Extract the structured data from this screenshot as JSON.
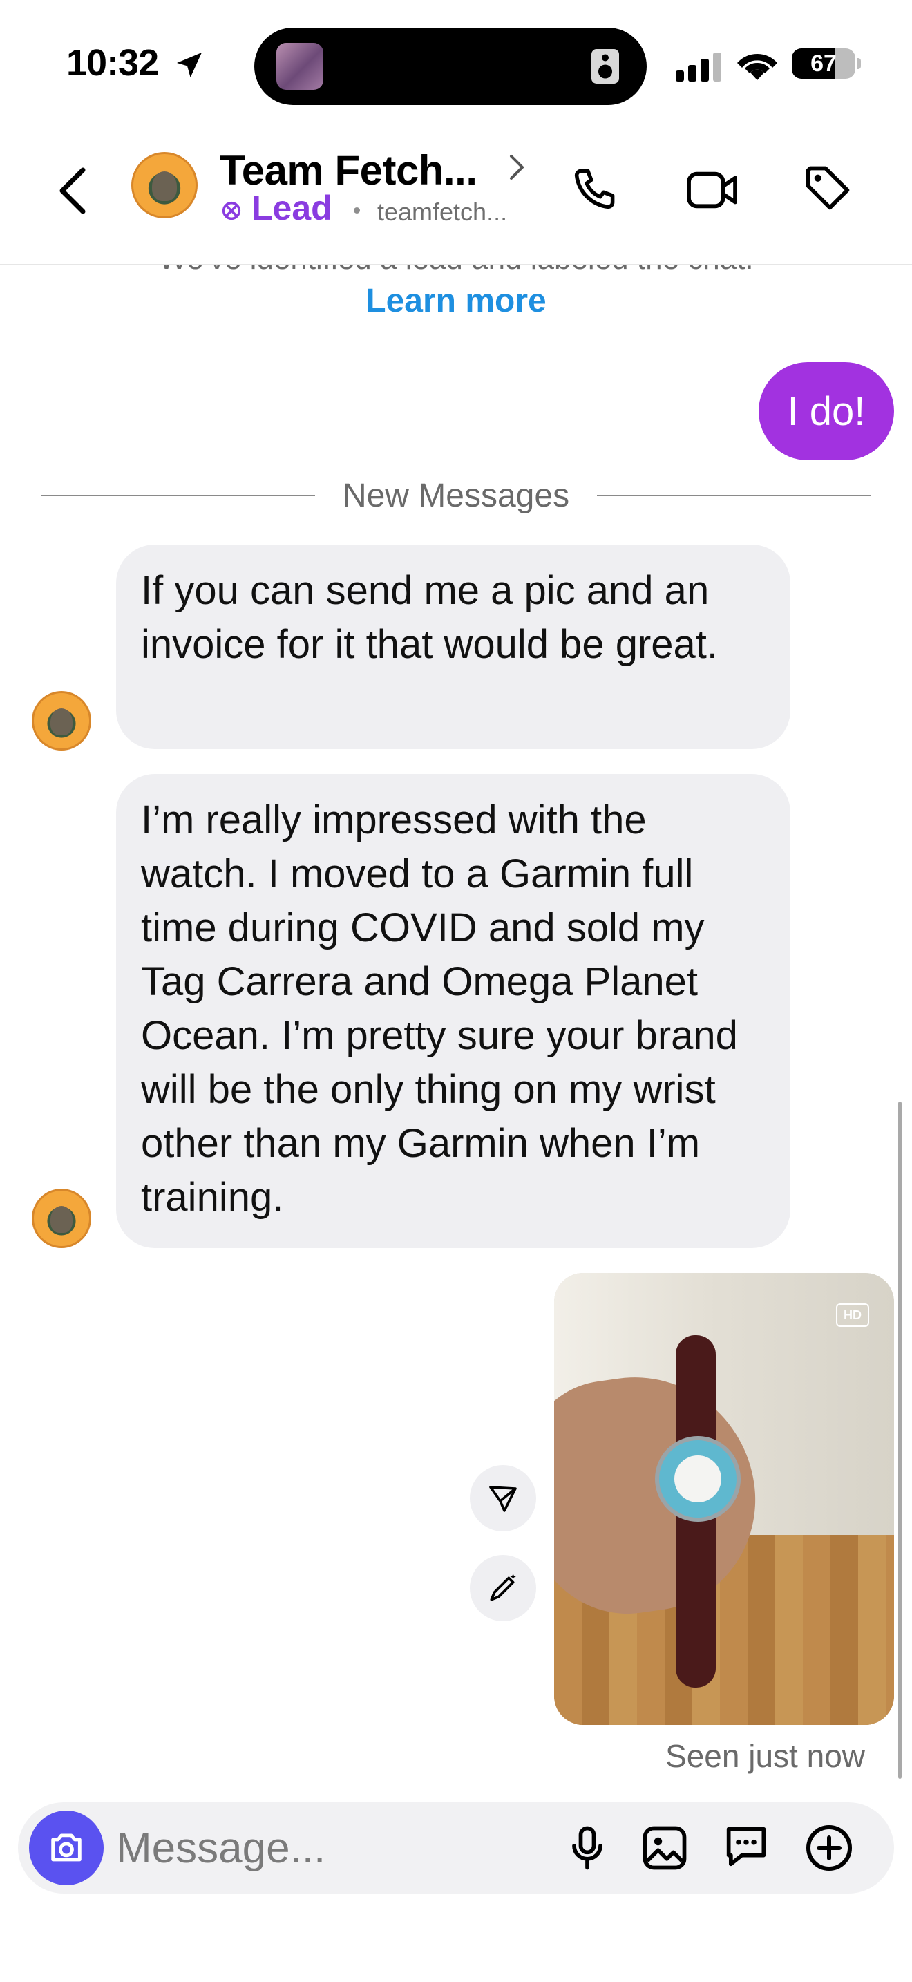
{
  "status_bar": {
    "time": "10:32",
    "battery": "67"
  },
  "header": {
    "title": "Team Fetch...",
    "label": "Lead",
    "handle": "teamfetch..."
  },
  "chat": {
    "notice_partial": "We've identified a lead and labeled the chat.",
    "learn_more": "Learn more",
    "outgoing_message": "I do!",
    "divider": "New Messages",
    "incoming": [
      {
        "text": "If you can send me a pic and an invoice for it that would be great."
      },
      {
        "text": "I’m really impressed with the watch.  I moved to a Garmin full time during COVID and sold my Tag Carrera and Omega Planet Ocean.  I’m pretty sure your brand will be the only thing on my wrist other than my Garmin when I’m training."
      }
    ],
    "photo_badge": "HD",
    "seen": "Seen just now"
  },
  "composer": {
    "placeholder": "Message..."
  },
  "colors": {
    "accent_purple": "#a232e0",
    "link_blue": "#1e8fe0",
    "camera_blue": "#5a52f0"
  },
  "icons": [
    "location-arrow-icon",
    "signal-icon",
    "wifi-icon",
    "battery-icon",
    "back-chevron-icon",
    "phone-icon",
    "video-icon",
    "tag-icon",
    "lead-icon",
    "send-icon",
    "edit-icon",
    "camera-icon",
    "mic-icon",
    "gallery-icon",
    "sticker-icon",
    "plus-icon"
  ]
}
